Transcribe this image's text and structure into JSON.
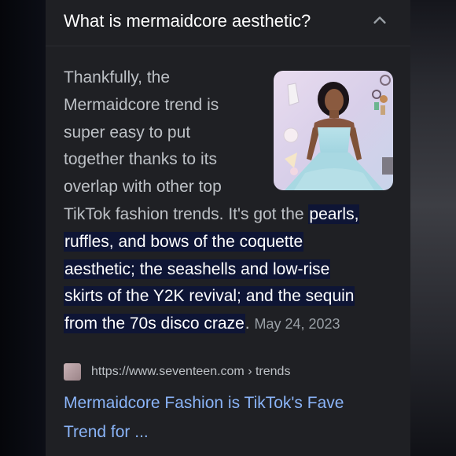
{
  "question": "What is mermaidcore aesthetic?",
  "answer": {
    "plain_lines": [
      "Thankfully, the",
      "Mermaidcore trend is",
      "super easy to put",
      "together thanks to its",
      "overlap with other top",
      "TikTok fashion trends. It's got the "
    ],
    "highlight_lines": [
      "pearls,",
      "ruffles, and bows of the coquette",
      "aesthetic; the seashells and low-rise",
      "skirts of the Y2K revival; and the sequin",
      "from the 70s disco craze"
    ],
    "trailing": ".",
    "date": "May 24, 2023"
  },
  "source": {
    "url": "https://www.seventeen.com › trends",
    "title_lines": [
      "Mermaidcore Fashion is TikTok's Fave",
      "Trend for ..."
    ]
  },
  "icons": {
    "expand": "chevron-up-icon",
    "favicon": "seventeen-favicon"
  },
  "colors": {
    "panel_bg": "#1f2024",
    "highlight_bg": "#0e1535",
    "link": "#8ab4f8",
    "body_text": "#bdc1c6"
  }
}
